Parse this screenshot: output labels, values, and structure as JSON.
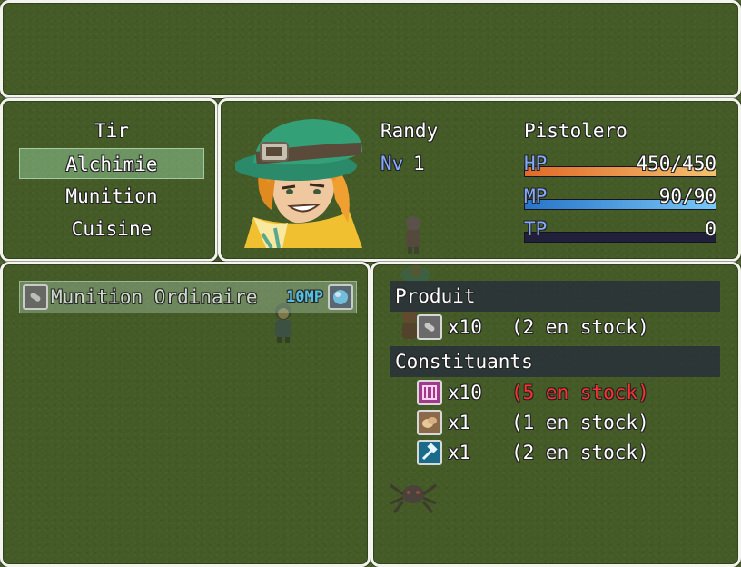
{
  "help": {
    "text": ""
  },
  "categories": [
    "Tir",
    "Alchimie",
    "Munition",
    "Cuisine"
  ],
  "selected_category": 1,
  "actor": {
    "name": "Randy",
    "class": "Pistolero",
    "level_label": "Nv",
    "level": "1",
    "hp": {
      "label": "HP",
      "value": "450/450",
      "fraction": 1.0
    },
    "mp": {
      "label": "MP",
      "value": "90/90",
      "fraction": 1.0
    },
    "tp": {
      "label": "TP",
      "value": "0",
      "fraction": 0.0
    }
  },
  "recipes": [
    {
      "name": "Munition Ordinaire",
      "cost": "10MP",
      "icon": "bullet-icon",
      "cost_icon": "orb-icon"
    }
  ],
  "info": {
    "product_header": "Produit",
    "product": {
      "icon": "bullet-icon",
      "qty": "x10",
      "stock": "(2 en stock)"
    },
    "ingredients_header": "Constituants",
    "ingredients": [
      {
        "icon": "crate-icon",
        "qty": "x10",
        "stock": "(5 en stock)",
        "insufficient": true
      },
      {
        "icon": "ore-icon",
        "qty": "x1",
        "stock": "(1 en stock)",
        "insufficient": false
      },
      {
        "icon": "hammer-icon",
        "qty": "x1",
        "stock": "(2 en stock)",
        "insufficient": false
      }
    ]
  },
  "colors": {
    "hp_from": "#e06a28",
    "hp_to": "#f4c070",
    "mp_from": "#2874c8",
    "mp_to": "#78c8f8",
    "system": "#84aaff",
    "shortage": "#ff3030"
  }
}
